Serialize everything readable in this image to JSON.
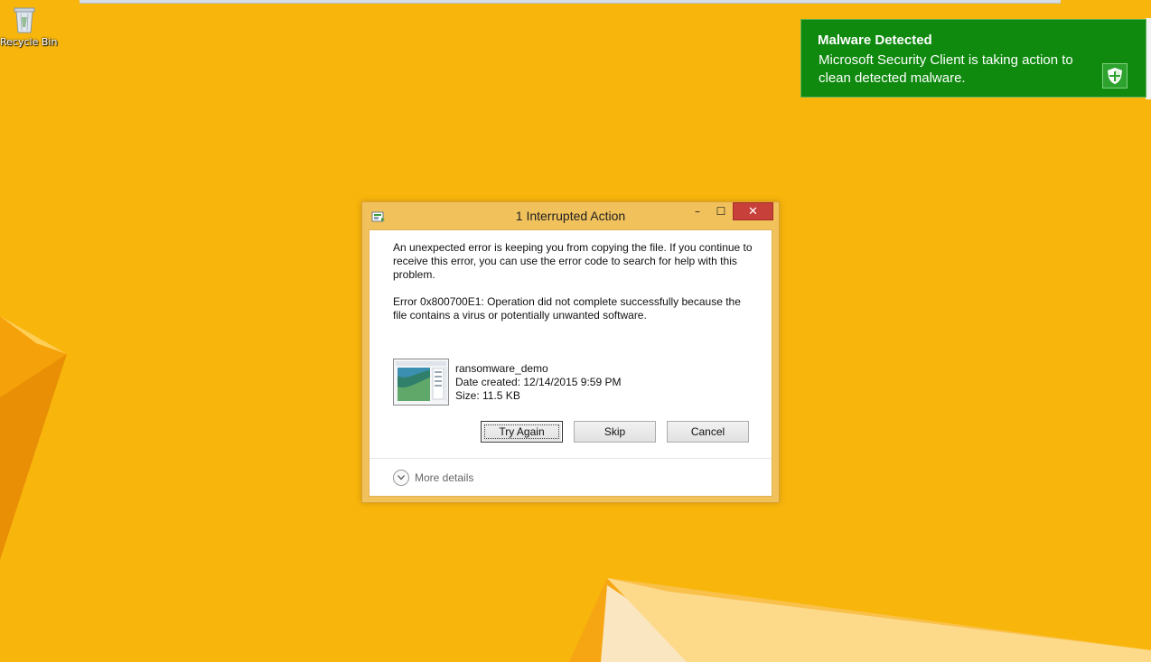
{
  "desktop": {
    "recycle_bin_label": "Recycle Bin"
  },
  "toast": {
    "title": "Malware Detected",
    "body": "Microsoft Security Client is taking action to clean detected malware.",
    "icon": "shield-icon"
  },
  "dialog": {
    "title": "1 Interrupted Action",
    "minimize_label": "–",
    "maximize_label": "☐",
    "close_label": "✕",
    "message": "An unexpected error is keeping you from copying the file. If you continue to receive this error, you can use the error code to search for help with this problem.",
    "error_text": "Error 0x800700E1: Operation did not complete successfully because the file contains a virus or potentially unwanted software.",
    "file": {
      "name": "ransomware_demo",
      "date_created": "Date created: 12/14/2015 9:59 PM",
      "size": "Size: 11.5 KB"
    },
    "buttons": {
      "try_again": "Try Again",
      "skip": "Skip",
      "cancel": "Cancel"
    },
    "more_details": "More details"
  },
  "colors": {
    "desktop_bg": "#f8b60c",
    "toast_bg": "#0f8a0f",
    "dialog_frame": "#f1c15b",
    "close_button": "#c7403a"
  }
}
